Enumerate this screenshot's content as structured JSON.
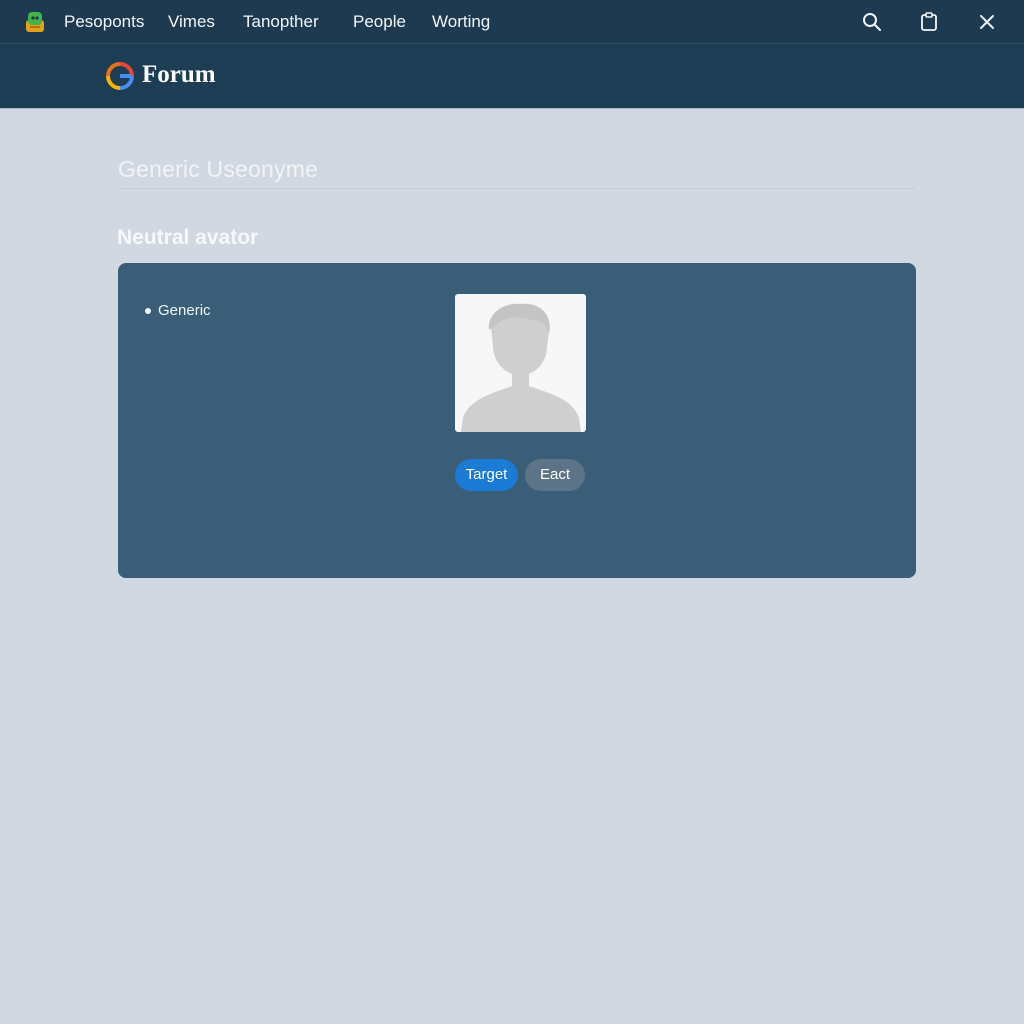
{
  "titlebar": {
    "nav": [
      "Pesoponts",
      "Vimes",
      "Tanopther",
      "People",
      "Worting"
    ],
    "icons": [
      "app-icon",
      "search-icon",
      "clipboard-icon",
      "close-icon"
    ]
  },
  "header": {
    "brand": "Forum",
    "logo_icon": "logo-icon"
  },
  "profile": {
    "username": "Generic Useonyme",
    "section_title": "Neutral avator",
    "bullet_item": "Generic",
    "avatar_icon": "avatar-silhouette-icon",
    "primary_button": "Target",
    "secondary_button": "Eact"
  },
  "colors": {
    "titlebar": "#1d3a50",
    "header": "#1c3d54",
    "background": "#d1d8e1",
    "panel": "#3a5d78",
    "primary_button": "#1a7ad4",
    "secondary_button": "#5d7488"
  }
}
